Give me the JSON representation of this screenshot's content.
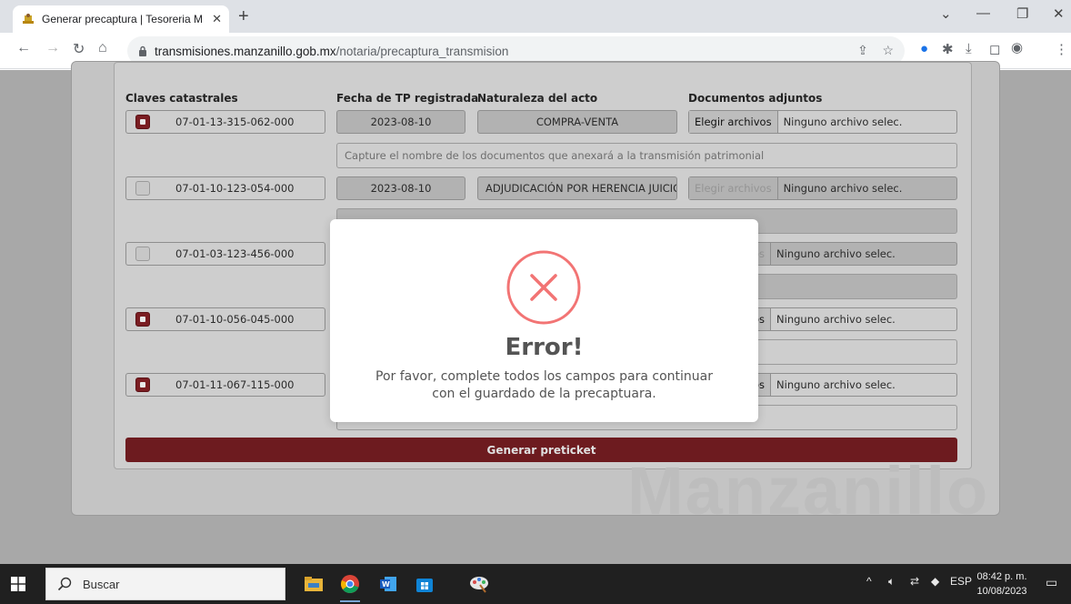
{
  "browser": {
    "tab_title": "Generar precaptura | Tesoreria M",
    "new_tab": "+",
    "url_host": "transmisiones.manzanillo.gob.mx",
    "url_path": "/notaria/precaptura_transmision"
  },
  "table": {
    "headers": {
      "claves": "Claves catastrales",
      "fecha": "Fecha de TP registrada",
      "naturaleza": "Naturaleza del acto",
      "documentos": "Documentos adjuntos"
    },
    "rows": [
      {
        "clave": "07-01-13-315-062-000",
        "fecha": "2023-08-10",
        "naturaleza": "COMPRA-VENTA",
        "file_btn": "Elegir archivos",
        "file_status": "Ninguno archivo selec.",
        "checked": true,
        "description_placeholder": "Capture el nombre de los documentos que anexará a la transmisión patrimonial"
      },
      {
        "clave": "07-01-10-123-054-000",
        "fecha": "2023-08-10",
        "naturaleza": "ADJUDICACIÓN POR HERENCIA JUICIO",
        "file_btn": "Elegir archivos",
        "file_status": "Ninguno archivo selec.",
        "checked": false
      },
      {
        "clave": "07-01-03-123-456-000",
        "file_btn_partial": "os",
        "file_status": "Ninguno archivo selec.",
        "checked": false
      },
      {
        "clave": "07-01-10-056-045-000",
        "file_btn_partial": "os",
        "file_status": "Ninguno archivo selec.",
        "checked": true
      },
      {
        "clave": "07-01-11-067-115-000",
        "file_btn_partial": "os",
        "file_status": "Ninguno archivo selec.",
        "checked": true
      }
    ],
    "generate_button": "Generar preticket",
    "watermark": "Manzanillo"
  },
  "modal": {
    "title": "Error!",
    "message": "Por favor, complete todos los campos para continuar con el guardado de la precaptuara."
  },
  "taskbar": {
    "search_label": "Buscar",
    "language": "ESP",
    "time": "08:42 p. m.",
    "date": "10/08/2023"
  }
}
